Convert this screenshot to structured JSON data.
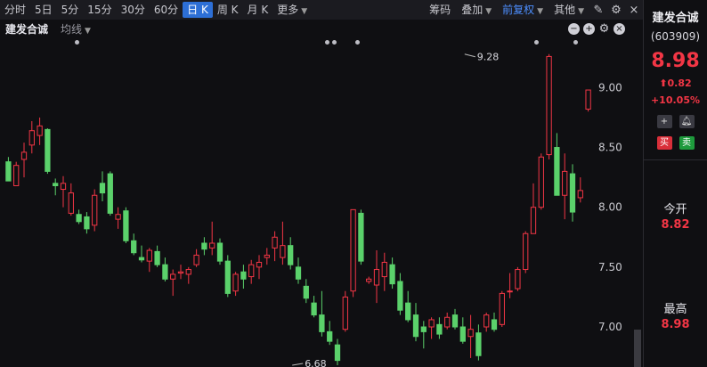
{
  "toolbar": {
    "periods": [
      "分时",
      "5日",
      "5分",
      "15分",
      "30分",
      "60分",
      "日 K",
      "周 K",
      "月 K",
      "更多"
    ],
    "active_index": 6,
    "right_items": [
      "筹码",
      "叠加",
      "前复权",
      "其他"
    ]
  },
  "subbar": {
    "stock": "建发合诚",
    "ma_label": "均线"
  },
  "panel": {
    "name": "建发合诚",
    "code": "(603909)",
    "price": "8.98",
    "change": "0.82",
    "pct": "+10.05%",
    "btn_buy": "买",
    "btn_sell": "卖",
    "open_label": "今开",
    "open_value": "8.82",
    "high_label": "最高",
    "high_value": "8.98"
  },
  "colors": {
    "up": "#f23645",
    "down": "#5bd16b",
    "bg": "#0f0f12",
    "accent": "#2d6fd6"
  },
  "chart_data": {
    "type": "candlestick",
    "ylim": [
      6.68,
      9.36
    ],
    "y_ticks": [
      "9.00",
      "8.50",
      "8.00",
      "7.50",
      "7.00"
    ],
    "y_tick_values": [
      9.0,
      8.5,
      8.0,
      7.5,
      7.0
    ],
    "annotations": [
      {
        "label": "9.28",
        "value": 9.28,
        "index": 58
      },
      {
        "label": "6.68",
        "value": 6.68,
        "index": 36
      }
    ],
    "candles": [
      [
        8.38,
        8.42,
        8.22,
        8.22
      ],
      [
        8.18,
        8.38,
        8.22,
        8.35
      ],
      [
        8.4,
        8.54,
        8.25,
        8.46
      ],
      [
        8.52,
        8.72,
        8.45,
        8.64
      ],
      [
        8.6,
        8.75,
        8.52,
        8.68
      ],
      [
        8.65,
        8.66,
        8.28,
        8.3
      ],
      [
        8.2,
        8.24,
        8.1,
        8.18
      ],
      [
        8.15,
        8.26,
        8.0,
        8.2
      ],
      [
        7.95,
        8.2,
        7.93,
        8.12
      ],
      [
        7.94,
        7.98,
        7.86,
        7.88
      ],
      [
        7.92,
        7.96,
        7.78,
        7.82
      ],
      [
        7.85,
        8.15,
        7.8,
        8.1
      ],
      [
        8.2,
        8.3,
        8.05,
        8.12
      ],
      [
        8.28,
        8.3,
        7.93,
        7.95
      ],
      [
        7.9,
        8.0,
        7.82,
        7.94
      ],
      [
        7.97,
        8.0,
        7.7,
        7.72
      ],
      [
        7.72,
        7.78,
        7.6,
        7.62
      ],
      [
        7.58,
        7.68,
        7.54,
        7.56
      ],
      [
        7.55,
        7.66,
        7.46,
        7.64
      ],
      [
        7.63,
        7.68,
        7.5,
        7.52
      ],
      [
        7.52,
        7.58,
        7.38,
        7.4
      ],
      [
        7.4,
        7.48,
        7.26,
        7.44
      ],
      [
        7.45,
        7.52,
        7.4,
        7.46
      ],
      [
        7.44,
        7.5,
        7.36,
        7.48
      ],
      [
        7.52,
        7.65,
        7.5,
        7.6
      ],
      [
        7.7,
        7.75,
        7.6,
        7.65
      ],
      [
        7.66,
        7.88,
        7.6,
        7.7
      ],
      [
        7.7,
        7.74,
        7.52,
        7.55
      ],
      [
        7.55,
        7.6,
        7.25,
        7.28
      ],
      [
        7.3,
        7.46,
        7.26,
        7.44
      ],
      [
        7.46,
        7.52,
        7.32,
        7.4
      ],
      [
        7.42,
        7.56,
        7.36,
        7.52
      ],
      [
        7.5,
        7.6,
        7.4,
        7.54
      ],
      [
        7.58,
        7.66,
        7.52,
        7.6
      ],
      [
        7.66,
        7.8,
        7.55,
        7.75
      ],
      [
        7.58,
        7.88,
        7.52,
        7.68
      ],
      [
        7.68,
        7.75,
        7.48,
        7.52
      ],
      [
        7.5,
        7.58,
        7.36,
        7.4
      ],
      [
        7.34,
        7.4,
        7.2,
        7.24
      ],
      [
        7.2,
        7.26,
        7.08,
        7.1
      ],
      [
        7.1,
        7.3,
        6.92,
        6.96
      ],
      [
        6.96,
        7.05,
        6.85,
        6.88
      ],
      [
        6.85,
        6.9,
        6.68,
        6.72
      ],
      [
        6.98,
        7.3,
        6.96,
        7.25
      ],
      [
        7.3,
        7.98,
        7.25,
        7.98
      ],
      [
        7.95,
        7.98,
        7.52,
        7.55
      ],
      [
        7.38,
        7.42,
        7.36,
        7.4
      ],
      [
        7.35,
        7.64,
        7.2,
        7.48
      ],
      [
        7.42,
        7.62,
        7.3,
        7.54
      ],
      [
        7.52,
        7.58,
        7.32,
        7.36
      ],
      [
        7.38,
        7.45,
        7.1,
        7.14
      ],
      [
        7.2,
        7.3,
        7.04,
        7.06
      ],
      [
        7.1,
        7.2,
        6.88,
        6.92
      ],
      [
        7.0,
        7.05,
        6.82,
        6.96
      ],
      [
        7.0,
        7.08,
        6.9,
        7.06
      ],
      [
        7.02,
        7.08,
        6.9,
        6.94
      ],
      [
        7.0,
        7.12,
        6.98,
        7.08
      ],
      [
        7.1,
        7.15,
        6.98,
        7.0
      ],
      [
        7.0,
        7.08,
        6.86,
        6.88
      ],
      [
        6.92,
        7.1,
        6.74,
        6.98
      ],
      [
        6.95,
        7.02,
        6.72,
        6.76
      ],
      [
        7.0,
        7.12,
        6.96,
        7.1
      ],
      [
        7.06,
        7.12,
        6.96,
        6.98
      ],
      [
        7.02,
        7.3,
        7.0,
        7.28
      ],
      [
        7.3,
        7.45,
        7.24,
        7.3
      ],
      [
        7.32,
        7.5,
        7.3,
        7.48
      ],
      [
        7.48,
        7.8,
        7.45,
        7.78
      ],
      [
        7.78,
        8.2,
        7.78,
        8.0
      ],
      [
        8.0,
        8.45,
        7.98,
        8.42
      ],
      [
        8.44,
        9.28,
        8.4,
        9.26
      ],
      [
        8.5,
        8.62,
        8.1,
        8.1
      ],
      [
        8.1,
        8.45,
        7.9,
        8.3
      ],
      [
        8.28,
        8.36,
        7.88,
        7.96
      ],
      [
        8.08,
        8.25,
        8.04,
        8.14
      ],
      [
        8.82,
        8.98,
        8.8,
        8.98
      ]
    ]
  }
}
